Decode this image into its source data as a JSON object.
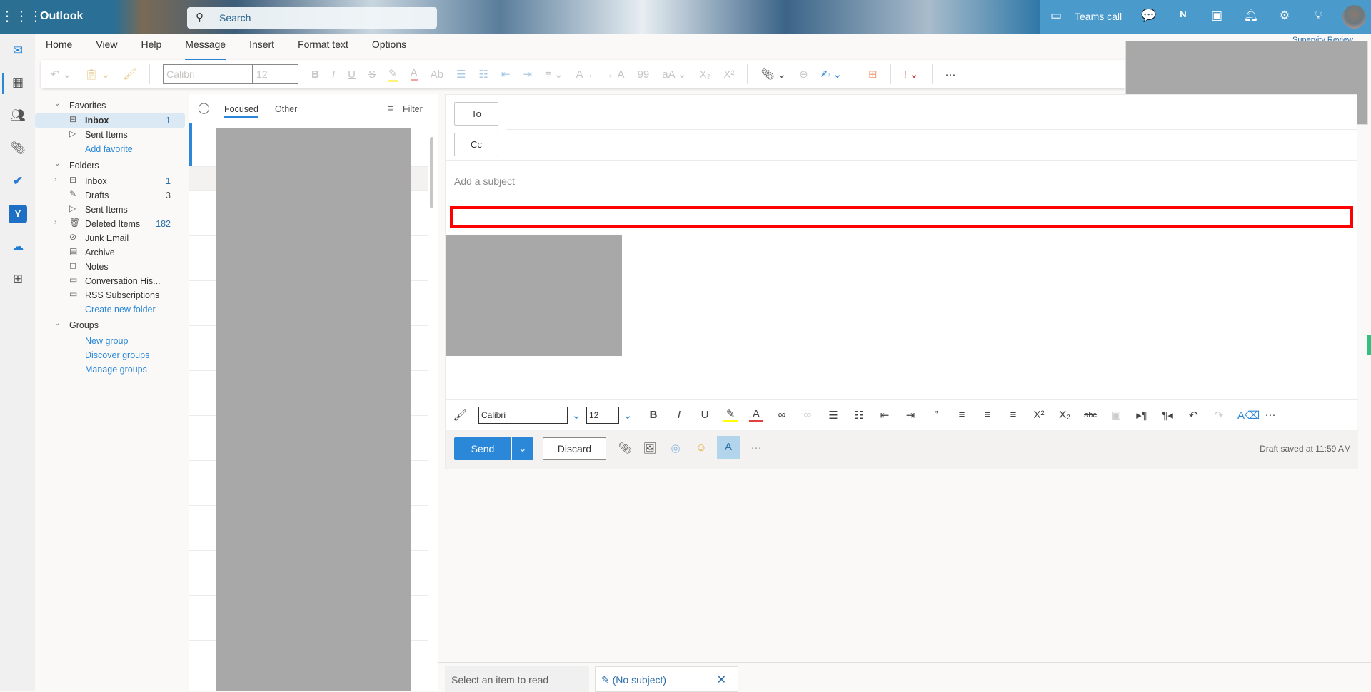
{
  "header": {
    "app_name": "Outlook",
    "search_placeholder": "Search",
    "teams_call": "Teams call",
    "icons": [
      "waffle-icon",
      "video-icon",
      "chat-icon",
      "onenote-icon",
      "calendar-edit-icon",
      "bell-icon",
      "gear-icon",
      "lightbulb-icon",
      "avatar"
    ]
  },
  "rail": {
    "icons": [
      "mail-icon",
      "calendar-icon",
      "people-icon",
      "attachment-icon",
      "todo-icon",
      "yammer-icon",
      "onedrive-icon",
      "apps-icon"
    ]
  },
  "tabs": [
    "Home",
    "View",
    "Help",
    "Message",
    "Insert",
    "Format text",
    "Options"
  ],
  "active_tab": "Message",
  "ribbon": {
    "font": "Calibri",
    "size": "12",
    "more": "···"
  },
  "supervity": "Supervity Review",
  "folders": {
    "favorites_label": "Favorites",
    "favorites": [
      {
        "label": "Inbox",
        "count": "1"
      },
      {
        "label": "Sent Items",
        "count": ""
      }
    ],
    "add_favorite": "Add favorite",
    "folders_label": "Folders",
    "items": [
      {
        "label": "Inbox",
        "count": "1"
      },
      {
        "label": "Drafts",
        "count": "3"
      },
      {
        "label": "Sent Items",
        "count": ""
      },
      {
        "label": "Deleted Items",
        "count": "182"
      },
      {
        "label": "Junk Email",
        "count": ""
      },
      {
        "label": "Archive",
        "count": ""
      },
      {
        "label": "Notes",
        "count": ""
      },
      {
        "label": "Conversation His...",
        "count": ""
      },
      {
        "label": "RSS Subscriptions",
        "count": ""
      }
    ],
    "create_folder": "Create new folder",
    "groups_label": "Groups",
    "groups": [
      "New group",
      "Discover groups",
      "Manage groups"
    ]
  },
  "list": {
    "focused": "Focused",
    "other": "Other",
    "filter": "Filter"
  },
  "compose": {
    "to": "To",
    "cc": "Cc",
    "subject_placeholder": "Add a subject",
    "font": "Calibri",
    "size": "12",
    "send": "Send",
    "discard": "Discard",
    "more": "···",
    "draft_saved": "Draft saved at 11:59 AM"
  },
  "bottom": {
    "read_tab": "Select an item to read",
    "draft_tab": "(No subject)"
  },
  "colors": {
    "accent": "#2b88d8",
    "highlight_box": "#ff0000"
  }
}
